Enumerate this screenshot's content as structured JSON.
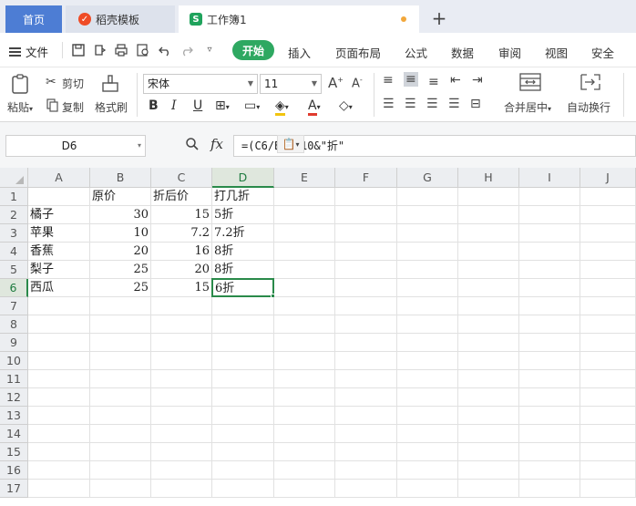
{
  "tabs": {
    "home": "首页",
    "template": "稻壳模板",
    "workbook": "工作簿1",
    "plus": "+"
  },
  "menu": {
    "file": "文件",
    "start": "开始",
    "items": [
      "插入",
      "页面布局",
      "公式",
      "数据",
      "审阅",
      "视图",
      "安全"
    ]
  },
  "ribbon": {
    "paste": "粘贴",
    "cut": "剪切",
    "copy": "复制",
    "format_painter": "格式刷",
    "font": "宋体",
    "font_size": "11",
    "merge_center": "合并居中",
    "auto_wrap": "自动换行"
  },
  "formula_bar": {
    "cell_ref": "D6",
    "fx": "fx",
    "formula": "=(C6/B6)*10&\"折\""
  },
  "sheet": {
    "columns": [
      "A",
      "B",
      "C",
      "D",
      "E",
      "F",
      "G",
      "H",
      "I",
      "J"
    ],
    "rows": [
      "1",
      "2",
      "3",
      "4",
      "5",
      "6",
      "7",
      "8",
      "9",
      "10",
      "11",
      "12",
      "13",
      "14",
      "15",
      "16",
      "17"
    ],
    "cells": [
      [
        "",
        "原价",
        "折后价",
        "打几折"
      ],
      [
        "橘子",
        "30",
        "15",
        "5折"
      ],
      [
        "苹果",
        "10",
        "7.2",
        "7.2折"
      ],
      [
        "香蕉",
        "20",
        "16",
        "8折"
      ],
      [
        "梨子",
        "25",
        "20",
        "8折"
      ],
      [
        "西瓜",
        "25",
        "15",
        "6折"
      ]
    ],
    "selected_cell": "D6"
  }
}
